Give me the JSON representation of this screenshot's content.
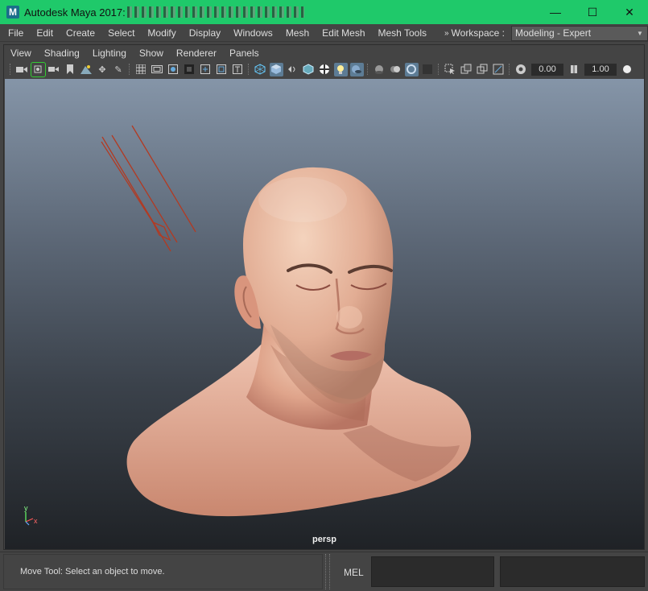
{
  "window": {
    "logo": "M",
    "title": "Autodesk Maya 2017:",
    "controls": {
      "minimize": "—",
      "maximize": "☐",
      "close": "✕"
    }
  },
  "main_menu": {
    "items": [
      "File",
      "Edit",
      "Create",
      "Select",
      "Modify",
      "Display",
      "Windows",
      "Mesh",
      "Edit Mesh",
      "Mesh Tools"
    ],
    "workspace_label": "Workspace :",
    "workspace_value": "Modeling - Expert"
  },
  "panel_menu": {
    "items": [
      "View",
      "Shading",
      "Lighting",
      "Show",
      "Renderer",
      "Panels"
    ]
  },
  "panel_toolbar": {
    "exposure_value": "0.00",
    "gamma_value": "1.00"
  },
  "viewport": {
    "camera_name": "persp",
    "axis_y": "y",
    "axis_x": "x"
  },
  "status": {
    "help_line": "Move Tool: Select an object to move.",
    "command_language": "MEL"
  },
  "colors": {
    "title_bar": "#1fc96a",
    "ui_background": "#444444",
    "viewport_top": "#8595a8",
    "viewport_bottom": "#1f2226",
    "active_icon": "#5d7c95"
  }
}
